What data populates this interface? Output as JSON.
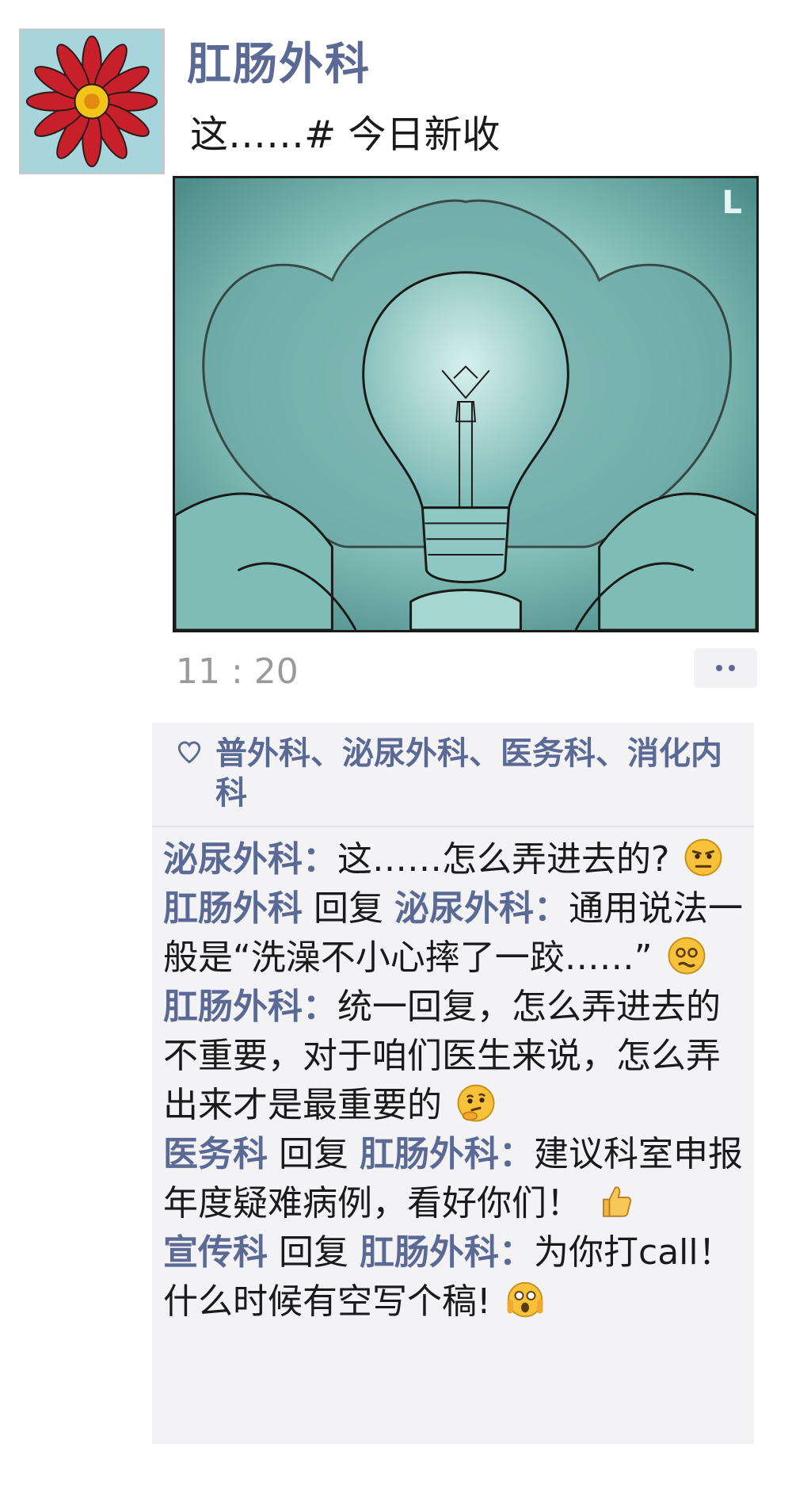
{
  "post": {
    "poster_name": "肛肠外科",
    "text": "这……# 今日新收",
    "time": "11 : 20",
    "image_corner_label": "L"
  },
  "likes": {
    "names": "普外科、泌尿外科、医务科、消化内科"
  },
  "comments": [
    {
      "name": "泌尿外科",
      "reply_to": "",
      "sep": "：",
      "text": "这……怎么弄进去的?",
      "emoji": "grimace-emoji"
    },
    {
      "name": "肛肠外科",
      "reply_word": "回复",
      "reply_to": "泌尿外科",
      "sep": "：",
      "text": "通用说法一般是“洗澡不小心摔了一跤……”",
      "emoji": "dizzy-emoji"
    },
    {
      "name": "肛肠外科",
      "reply_to": "",
      "sep": "：",
      "text": "统一回复，怎么弄进去的不重要，对于咱们医生来说，怎么弄出来才是最重要的",
      "emoji": "thinking-emoji"
    },
    {
      "name": "医务科",
      "reply_word": "回复",
      "reply_to": "肛肠外科",
      "sep": "：",
      "text": "建议科室申报年度疑难病例，看好你们！",
      "emoji": "thumbs-up-emoji"
    },
    {
      "name": "宣传科",
      "reply_word": "回复",
      "reply_to": "肛肠外科",
      "sep": "：",
      "text": "为你打call！什么时候有空写个稿!",
      "emoji": "scream-emoji"
    }
  ],
  "colors": {
    "name_blue": "#5b6a94",
    "image_teal": "#7ab8b4",
    "comment_bg": "#f3f3f5"
  }
}
